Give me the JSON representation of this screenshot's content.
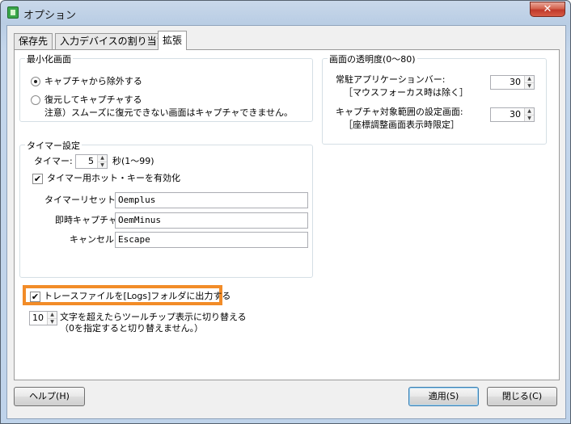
{
  "window": {
    "title": "オプション",
    "close_glyph": "✕",
    "icon": "app-icon"
  },
  "tabs": [
    {
      "label": "保存先"
    },
    {
      "label": "入力デバイスの割り当て"
    },
    {
      "label": "拡張",
      "active": true
    }
  ],
  "minimize_group": {
    "title": "最小化画面",
    "radio_exclude": {
      "label": "キャプチャから除外する",
      "selected": true
    },
    "radio_restore": {
      "label": "復元してキャプチャする",
      "selected": false
    },
    "note": "注意）スムーズに復元できない画面はキャプチャできません。"
  },
  "transparency_group": {
    "title": "画面の透明度(0〜80)",
    "resident_label": "常駐アプリケーションバー:",
    "resident_sub": "［マウスフォーカス時は除く］",
    "resident_value": "30",
    "capture_label": "キャプチャ対象範囲の設定画面:",
    "capture_sub": "［座標調整画面表示時限定］",
    "capture_value": "30"
  },
  "timer_group": {
    "title": "タイマー設定",
    "timer_label": "タイマー:",
    "timer_value": "5",
    "timer_unit": "秒(1〜99)",
    "hotkey_checkbox": {
      "label": "タイマー用ホット・キーを有効化",
      "checked": true
    },
    "reset_label": "タイマーリセット:",
    "reset_value": "Oemplus",
    "instant_label": "即時キャプチャ:",
    "instant_value": "OemMinus",
    "cancel_label": "キャンセル:",
    "cancel_value": "Escape"
  },
  "trace": {
    "label": "トレースファイルを[Logs]フォルダに出力する",
    "checked": true,
    "highlight_color": "#f28c28"
  },
  "tooltip": {
    "value": "10",
    "label": "文字を超えたらツールチップ表示に切り替える",
    "note": "（0を指定すると切り替えません。）"
  },
  "buttons": {
    "help": "ヘルプ(H)",
    "apply": "適用(S)",
    "close": "閉じる(C)"
  },
  "glyphs": {
    "check": "✔",
    "spin_up": "▲",
    "spin_down": "▼"
  }
}
